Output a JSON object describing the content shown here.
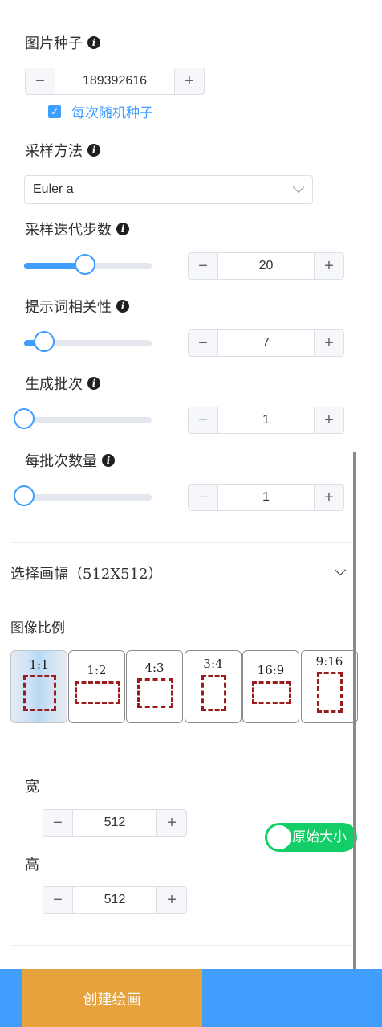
{
  "seed": {
    "label": "图片种子",
    "value": "189392616",
    "random_checkbox_label": "每次随机种子",
    "random_checked": true
  },
  "sampler": {
    "label": "采样方法",
    "selected": "Euler a"
  },
  "steps": {
    "label": "采样迭代步数",
    "value": "20",
    "slider_fraction": 0.48
  },
  "cfg": {
    "label": "提示词相关性",
    "value": "7",
    "slider_fraction": 0.155
  },
  "batch_count": {
    "label": "生成批次",
    "value": "1",
    "slider_fraction": 0.0
  },
  "batch_size": {
    "label": "每批次数量",
    "value": "1",
    "slider_fraction": 0.0
  },
  "canvas": {
    "section_title": "选择画幅（512X512）",
    "ratio_heading": "图像比例",
    "ratios": [
      "1:1",
      "1:2",
      "4:3",
      "3:4",
      "16:9",
      "9:16"
    ],
    "selected_ratio": "1:1",
    "width_label": "宽",
    "width_value": "512",
    "height_label": "高",
    "height_value": "512",
    "original_size_label": "原始大小",
    "original_size_on": true
  },
  "footer": {
    "create_button": "创建绘画"
  },
  "icons": {
    "info": "info-icon",
    "minus": "minus-icon",
    "plus": "plus-icon",
    "check": "check-icon",
    "chevron": "chevron-down-icon"
  },
  "colors": {
    "primary": "#409eff",
    "toggle_on": "#13ce66",
    "create_button": "#e6a23c",
    "ratio_shape": "#9b1c1c"
  },
  "glyphs": {
    "info": "i",
    "minus": "−",
    "plus": "+",
    "check": "✓"
  }
}
